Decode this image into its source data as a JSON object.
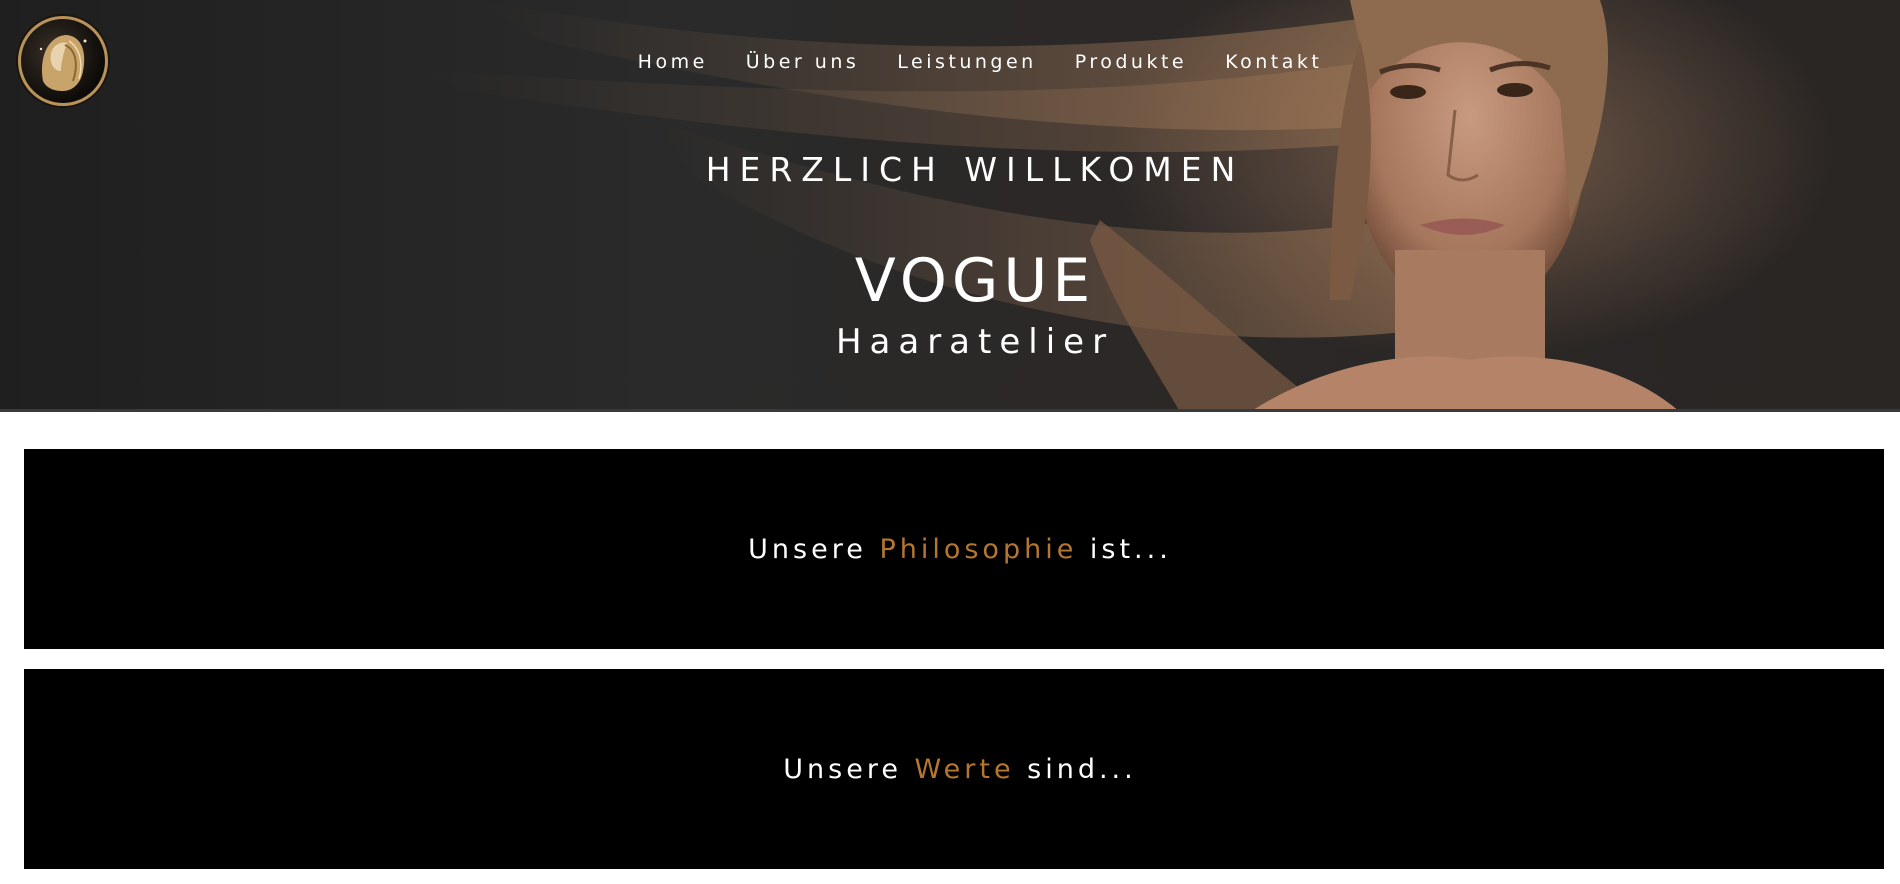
{
  "nav": {
    "items": [
      {
        "label": "Home"
      },
      {
        "label": "Über uns"
      },
      {
        "label": "Leistungen"
      },
      {
        "label": "Produkte"
      },
      {
        "label": "Kontakt"
      }
    ]
  },
  "hero": {
    "welcome": "HERZLICH WILLKOMEN",
    "brand": "VOGUE",
    "subtitle": "Haaratelier",
    "logo_icon": "woman-portrait-logo-icon"
  },
  "sections": {
    "philosophy": {
      "prefix": "Unsere",
      "highlight": "Philosophie",
      "suffix": "ist..."
    },
    "values": {
      "prefix": "Unsere",
      "highlight": "Werte",
      "suffix": "sind..."
    }
  },
  "colors": {
    "accent": "#b5772f",
    "panel_bg": "#000000",
    "hero_bg": "#262626",
    "text": "#ffffff"
  }
}
